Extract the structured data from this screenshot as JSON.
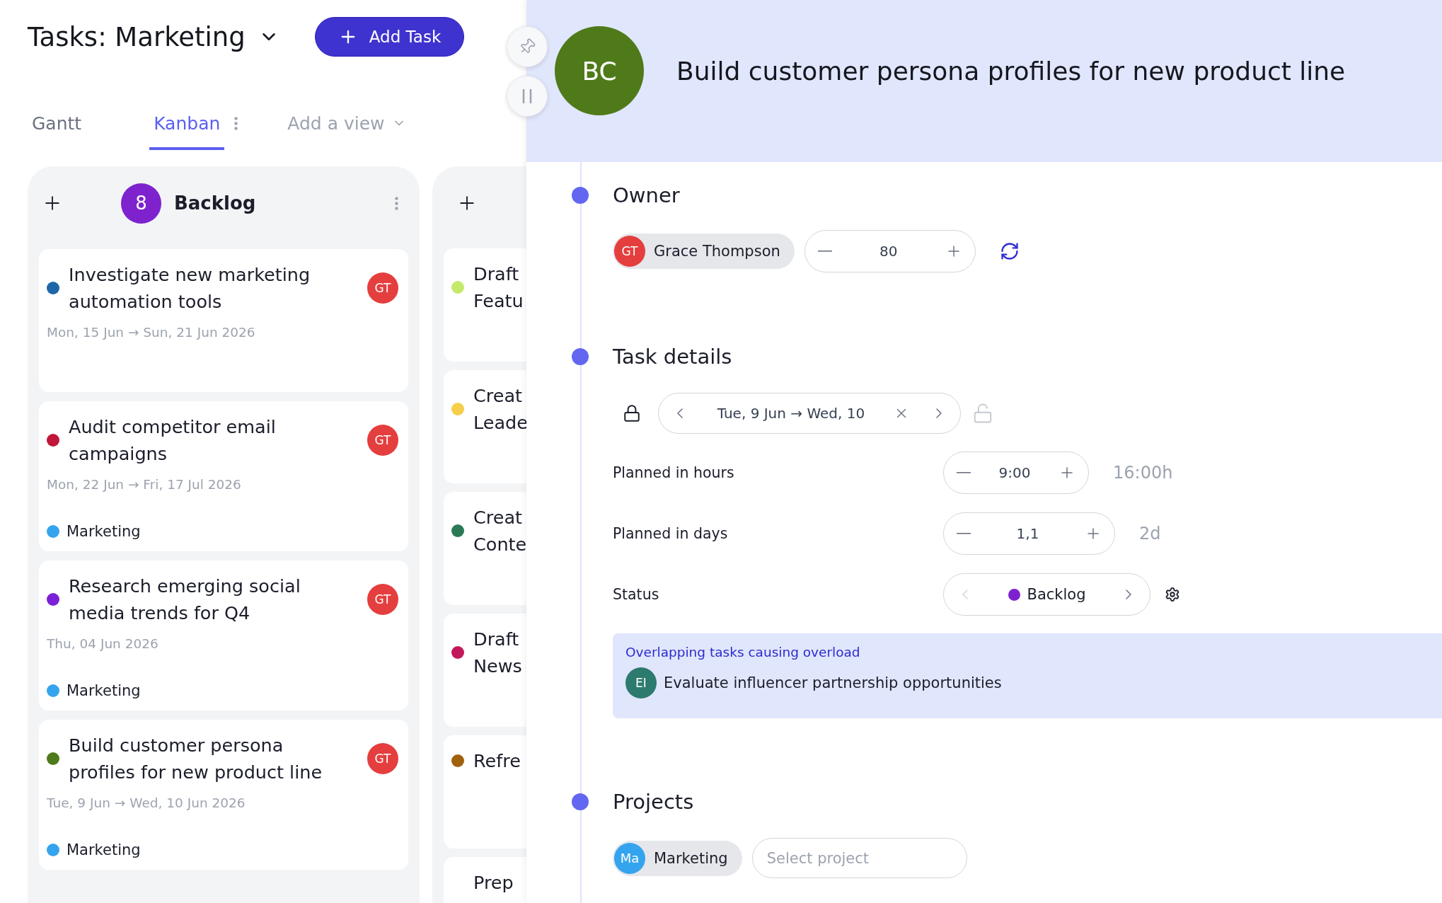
{
  "header": {
    "title": "Tasks: Marketing",
    "add_button": "Add Task"
  },
  "tabs": [
    {
      "label": "Gantt",
      "selected": false
    },
    {
      "label": "Kanban",
      "selected": true
    }
  ],
  "add_view": "Add a view",
  "backlog_column": {
    "count": "8",
    "name": "Backlog",
    "cards": [
      {
        "title": "Investigate new marketing automation tools",
        "dates": "Mon, 15 Jun → Sun, 21 Jun 2026",
        "color": "#1f66a8",
        "assignee": "GT"
      },
      {
        "title": "Audit competitor email campaigns",
        "dates": "Mon, 22 Jun → Fri, 17 Jul 2026",
        "color": "#c0163a",
        "assignee": "GT",
        "tag": {
          "name": "Marketing",
          "color": "#35a4ee"
        }
      },
      {
        "title": "Research emerging social media trends for Q4",
        "dates": "Thu, 04 Jun 2026",
        "color": "#7c1fd8",
        "assignee": "GT",
        "tag": {
          "name": "Marketing",
          "color": "#35a4ee"
        }
      },
      {
        "title": "Build customer persona profiles for new product line",
        "dates": "Tue, 9 Jun → Wed, 10 Jun 2026",
        "color": "#4f7a19",
        "assignee": "GT",
        "tag": {
          "name": "Marketing",
          "color": "#35a4ee"
        }
      }
    ]
  },
  "next_column": {
    "cards": [
      {
        "lines": [
          "Draft",
          "Featu"
        ],
        "color": "#c5ea6a"
      },
      {
        "lines": [
          "Creat",
          "Leade"
        ],
        "color": "#f5cf4b"
      },
      {
        "lines": [
          "Creat",
          "Conte"
        ],
        "color": "#2a7a55"
      },
      {
        "lines": [
          "Draft",
          "News"
        ],
        "color": "#c2185b"
      },
      {
        "lines": [
          "Refre"
        ],
        "color": "#a0610f"
      },
      {
        "lines": [
          "Prep"
        ]
      }
    ]
  },
  "task": {
    "initials": "BC",
    "title": "Build customer persona profiles for new product line"
  },
  "owner": {
    "heading": "Owner",
    "person": {
      "initials": "GT",
      "name": "Grace Thompson"
    },
    "allocation": "80"
  },
  "details": {
    "heading": "Task details",
    "date_range": "Tue, 9 Jun → Wed, 10",
    "rows": [
      {
        "kind": "stepper",
        "label": "Planned in hours",
        "value": "9:00",
        "total": "16:00h"
      },
      {
        "kind": "stepper",
        "label": "Planned in days",
        "value": "1,1",
        "total": "2d"
      },
      {
        "kind": "select",
        "label": "Status",
        "value": "Backlog",
        "color": "#7e22ce"
      }
    ]
  },
  "alert": {
    "title": "Overlapping tasks causing overload",
    "task": {
      "initials": "EI",
      "name": "Evaluate influencer partnership opportunities"
    }
  },
  "projects": {
    "heading": "Projects",
    "items": [
      {
        "initials": "Ma",
        "name": "Marketing"
      }
    ],
    "placeholder": "Select project"
  }
}
